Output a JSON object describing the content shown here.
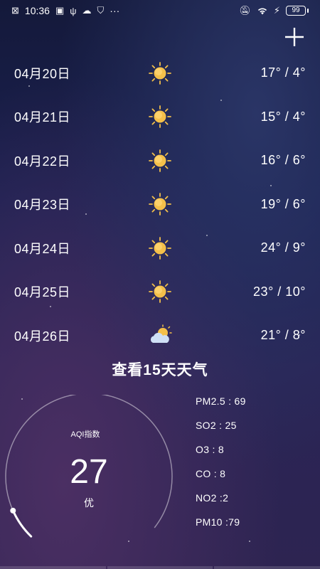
{
  "status_bar": {
    "time": "10:36",
    "more": "···",
    "battery": "99"
  },
  "forecast": [
    {
      "date": "04月20日",
      "icon": "sun-icon",
      "temp": "17° / 4°"
    },
    {
      "date": "04月21日",
      "icon": "sun-icon",
      "temp": "15° / 4°"
    },
    {
      "date": "04月22日",
      "icon": "sun-icon",
      "temp": "16° / 6°"
    },
    {
      "date": "04月23日",
      "icon": "sun-icon",
      "temp": "19° / 6°"
    },
    {
      "date": "04月24日",
      "icon": "sun-icon",
      "temp": "24° / 9°"
    },
    {
      "date": "04月25日",
      "icon": "sun-icon",
      "temp": "23° / 10°"
    },
    {
      "date": "04月26日",
      "icon": "partly-cloudy-icon",
      "temp": "21° / 8°"
    }
  ],
  "more_forecast_label": "查看15天天气",
  "aqi": {
    "label": "AQI指数",
    "value": "27",
    "level": "优",
    "level_fraction": 0.054
  },
  "pollutants": [
    "PM2.5 : 69",
    "SO2 : 25",
    "O3 : 8",
    "CO :  8",
    "NO2 :2",
    "PM10 :79"
  ],
  "colors": {
    "sun": "#f4c04a",
    "cloud": "#cfe0f5",
    "gauge_track": "rgba(255,255,255,0.45)",
    "gauge_progress": "#ffffff"
  }
}
